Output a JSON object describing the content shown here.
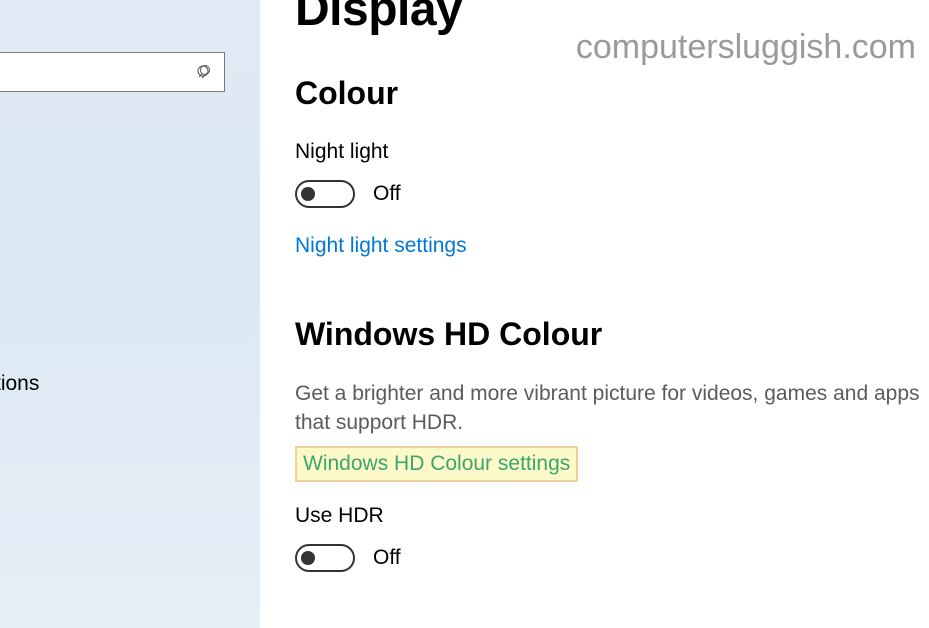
{
  "watermark": "computersluggish.com",
  "sidebar": {
    "partial_item": "tions"
  },
  "page": {
    "title": "Display"
  },
  "colour": {
    "heading": "Colour",
    "night_light_label": "Night light",
    "night_light_state": "Off",
    "night_light_link": "Night light settings"
  },
  "hd": {
    "heading": "Windows HD Colour",
    "description": "Get a brighter and more vibrant picture for videos, games and apps that support HDR.",
    "settings_link": "Windows HD Colour settings",
    "use_hdr_label": "Use HDR",
    "use_hdr_state": "Off"
  }
}
